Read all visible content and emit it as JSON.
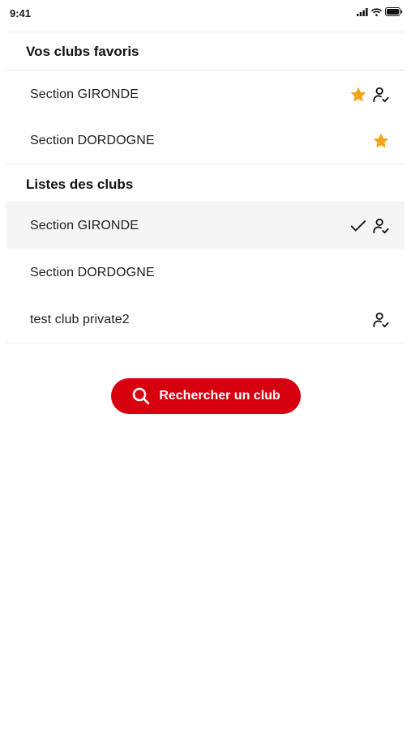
{
  "status_bar": {
    "time": "9:41"
  },
  "favorites": {
    "title": "Vos clubs favoris",
    "items": [
      {
        "label": "Section GIRONDE",
        "icons": [
          "star-icon",
          "user-check-icon"
        ]
      },
      {
        "label": "Section DORDOGNE",
        "icons": [
          "star-icon"
        ]
      }
    ]
  },
  "clubs": {
    "title": "Listes des clubs",
    "items": [
      {
        "label": "Section GIRONDE",
        "icons": [
          "checkmark-icon",
          "user-check-icon"
        ],
        "selected": true
      },
      {
        "label": "Section DORDOGNE",
        "icons": []
      },
      {
        "label": "test club private2",
        "icons": [
          "user-check-icon"
        ]
      }
    ]
  },
  "search_button": {
    "label": "Rechercher un club",
    "icon": "search-icon"
  },
  "colors": {
    "accent": "#d7000f",
    "star": "#f3a41a",
    "selected_row": "#f5f5f5"
  }
}
